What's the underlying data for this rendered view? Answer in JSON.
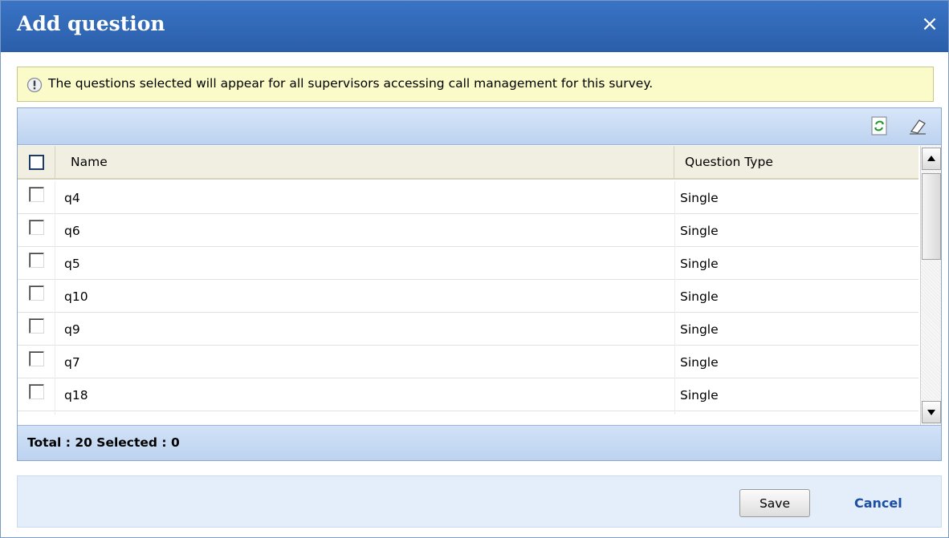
{
  "dialog": {
    "title": "Add question",
    "close_icon": "close-icon",
    "close_glyph": "×"
  },
  "info": {
    "icon": "info-icon",
    "text": "The questions selected will appear for all supervisors accessing call management for this survey."
  },
  "toolbar": {
    "refresh_icon": "refresh-icon",
    "clear_icon": "eraser-icon"
  },
  "table": {
    "columns": [
      "Name",
      "Question Type"
    ],
    "rows": [
      {
        "name": "q4",
        "type": "Single"
      },
      {
        "name": "q6",
        "type": "Single"
      },
      {
        "name": "q5",
        "type": "Single"
      },
      {
        "name": "q10",
        "type": "Single"
      },
      {
        "name": "q9",
        "type": "Single"
      },
      {
        "name": "q7",
        "type": "Single"
      },
      {
        "name": "q18",
        "type": "Single"
      },
      {
        "name": "",
        "type": ""
      }
    ]
  },
  "footer": {
    "total_text": "Total : 20 Selected : 0"
  },
  "actions": {
    "save_label": "Save",
    "cancel_label": "Cancel"
  },
  "colors": {
    "titlebar": "#3a74c6",
    "info_bg": "#fafbc8",
    "toolbar": "#c8dbf4",
    "link": "#1c4fa3"
  }
}
